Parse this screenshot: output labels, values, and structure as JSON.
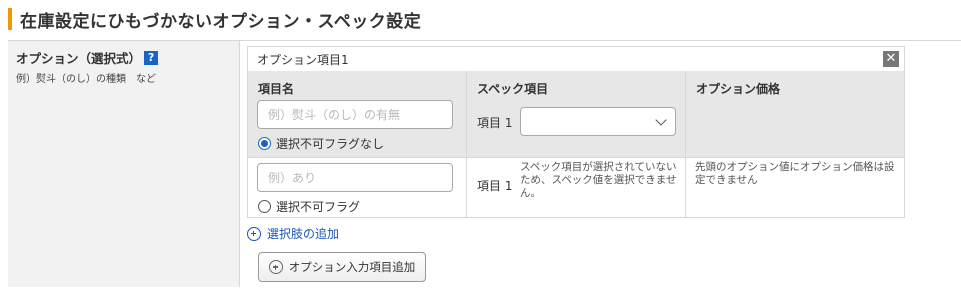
{
  "section": {
    "title": "在庫設定にひもづかないオプション・スペック設定",
    "accent_color": "#f39800"
  },
  "field": {
    "label": "オプション（選択式）",
    "help": "?",
    "example": "例）熨斗（のし）の種類　など"
  },
  "option_block": {
    "title": "オプション項目1",
    "close": "✕",
    "columns": {
      "item_name": "項目名",
      "spec_item": "スペック項目",
      "option_price": "オプション価格"
    },
    "row1": {
      "name_placeholder": "例）熨斗（のし）の有無",
      "radio_label": "選択不可フラグなし",
      "radio_checked": true,
      "spec_label": "項目 1",
      "spec_select_value": ""
    },
    "row2": {
      "name_placeholder": "例）あり",
      "radio_label": "選択不可フラグ",
      "radio_checked": false,
      "spec_label": "項目 1",
      "spec_note": "スペック項目が選択されていないため、スペック値を選択できません。",
      "price_note": "先頭のオプション値にオプション価格は設定できません"
    }
  },
  "actions": {
    "add_choice": "選択肢の追加",
    "add_option_item": "オプション入力項目追加"
  }
}
